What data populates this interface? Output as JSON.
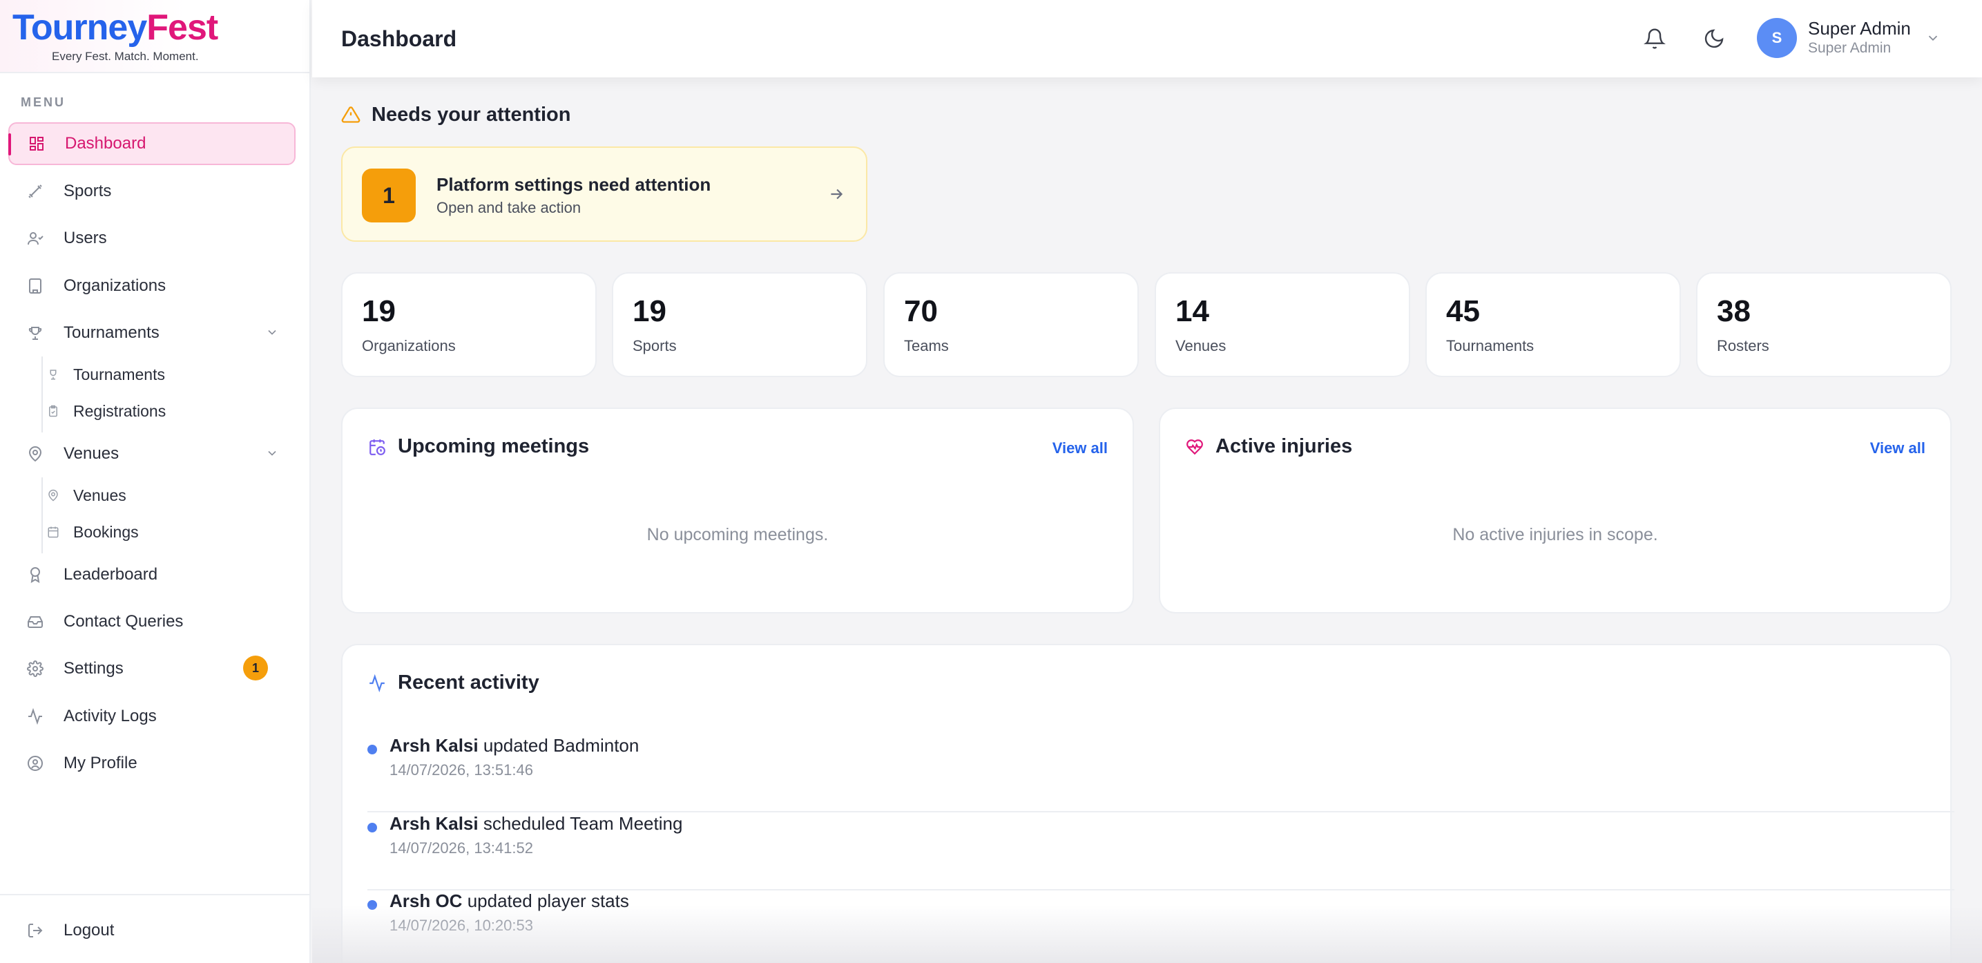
{
  "brand": {
    "name_part1": "Tourney",
    "name_part2": "Fest",
    "tagline": "Every Fest. Match. Moment."
  },
  "sidebar": {
    "menu_heading": "MENU",
    "items": {
      "dashboard": "Dashboard",
      "sports": "Sports",
      "users": "Users",
      "organizations": "Organizations",
      "tournaments": "Tournaments",
      "tournaments_sub": "Tournaments",
      "registrations": "Registrations",
      "venues": "Venues",
      "venues_sub": "Venues",
      "bookings": "Bookings",
      "leaderboard": "Leaderboard",
      "contact_queries": "Contact Queries",
      "settings": "Settings",
      "settings_badge": "1",
      "activity_logs": "Activity Logs",
      "my_profile": "My Profile",
      "logout": "Logout"
    }
  },
  "header": {
    "title": "Dashboard",
    "avatar_initial": "S",
    "user_name": "Super Admin",
    "user_role": "Super Admin"
  },
  "attention": {
    "title": "Needs your attention",
    "count": "1",
    "heading": "Platform settings need attention",
    "subtext": "Open and take action"
  },
  "stats": [
    {
      "value": "19",
      "label": "Organizations"
    },
    {
      "value": "19",
      "label": "Sports"
    },
    {
      "value": "70",
      "label": "Teams"
    },
    {
      "value": "14",
      "label": "Venues"
    },
    {
      "value": "45",
      "label": "Tournaments"
    },
    {
      "value": "38",
      "label": "Rosters"
    }
  ],
  "meetings": {
    "title": "Upcoming meetings",
    "view_all": "View all",
    "empty": "No upcoming meetings."
  },
  "injuries": {
    "title": "Active injuries",
    "view_all": "View all",
    "empty": "No active injuries in scope."
  },
  "activity": {
    "title": "Recent activity",
    "items": [
      {
        "actor": "Arsh Kalsi",
        "action": " updated Badminton",
        "time": "14/07/2026, 13:51:46"
      },
      {
        "actor": "Arsh Kalsi",
        "action": " scheduled Team Meeting",
        "time": "14/07/2026, 13:41:52"
      },
      {
        "actor": "Arsh OC",
        "action": " updated player stats",
        "time": "14/07/2026, 10:20:53"
      }
    ]
  },
  "colors": {
    "brand_blue": "#2563eb",
    "brand_pink": "#e0177a",
    "warning": "#f59e0b"
  },
  "icons": {
    "dashboard": "grid-icon",
    "sports": "dumbbell-icon",
    "users": "users-icon",
    "organizations": "building-icon",
    "tournaments": "trophy-icon",
    "venues": "map-pin-icon",
    "leaderboard": "award-icon",
    "contact": "inbox-icon",
    "settings": "gear-icon",
    "activity": "activity-icon",
    "profile": "user-circle-icon",
    "logout": "logout-icon"
  }
}
